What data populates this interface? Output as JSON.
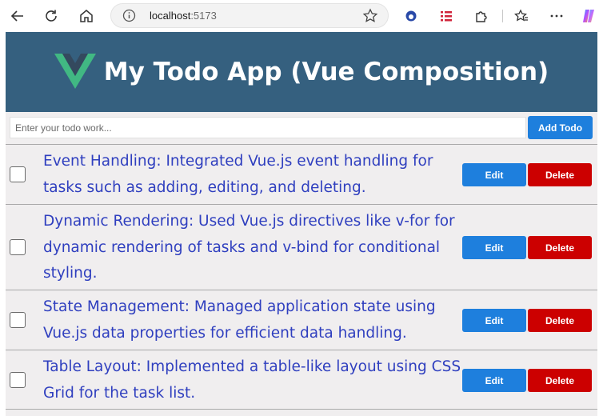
{
  "browser": {
    "url_host": "localhost",
    "url_port": ":5173"
  },
  "app": {
    "title": "My Todo App (Vue Composition)",
    "input_placeholder": "Enter your todo work...",
    "add_label": "Add Todo",
    "colors": {
      "header": "#35607f",
      "accent": "#1e7fdd",
      "danger": "#cc0000",
      "task_text": "#2f3fbf"
    }
  },
  "todos": [
    {
      "text": "Event Handling: Integrated Vue.js event handling for tasks such as adding, editing, and deleting.",
      "checked": false,
      "edit_label": "Edit",
      "delete_label": "Delete"
    },
    {
      "text": "Dynamic Rendering: Used Vue.js directives like v-for for dynamic rendering of tasks and v-bind for conditional styling.",
      "checked": false,
      "edit_label": "Edit",
      "delete_label": "Delete"
    },
    {
      "text": "State Management: Managed application state using Vue.js data properties for efficient data handling.",
      "checked": false,
      "edit_label": "Edit",
      "delete_label": "Delete"
    },
    {
      "text": "Table Layout: Implemented a table-like layout using CSS Grid for the task list.",
      "checked": false,
      "edit_label": "Edit",
      "delete_label": "Delete"
    }
  ]
}
